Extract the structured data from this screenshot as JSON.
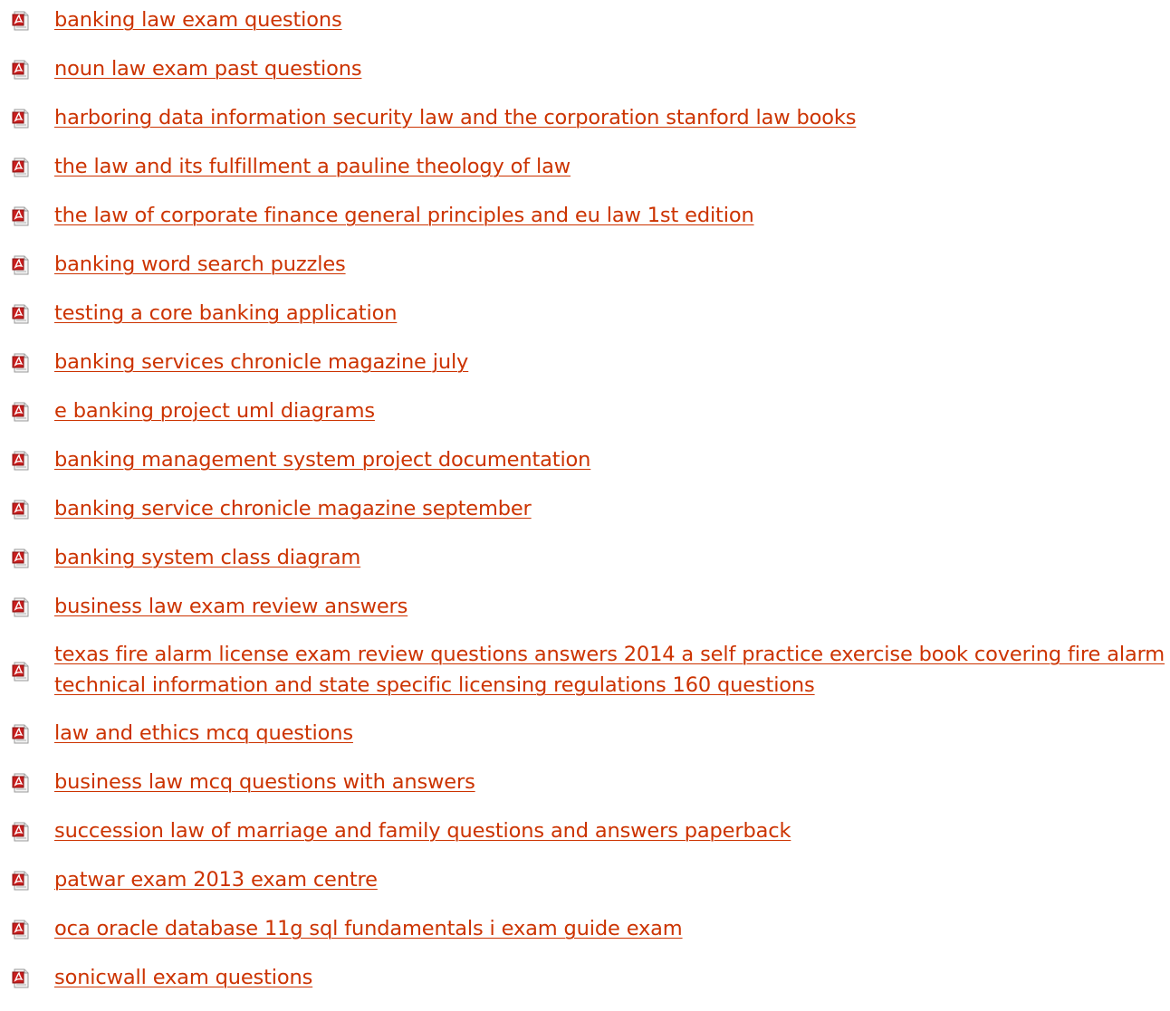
{
  "accent_color": "#cc3300",
  "icon": "pdf-file-icon",
  "links": [
    {
      "label": "banking law exam questions"
    },
    {
      "label": "noun law exam past questions"
    },
    {
      "label": "harboring data information security law and the corporation stanford law books"
    },
    {
      "label": "the law and its fulfillment a pauline theology of law"
    },
    {
      "label": "the law of corporate finance general principles and eu law 1st edition"
    },
    {
      "label": "banking word search puzzles"
    },
    {
      "label": "testing a core banking application"
    },
    {
      "label": "banking services chronicle magazine july"
    },
    {
      "label": "e banking project uml diagrams"
    },
    {
      "label": "banking management system project documentation"
    },
    {
      "label": "banking service chronicle magazine september"
    },
    {
      "label": "banking system class diagram"
    },
    {
      "label": "business law exam review answers"
    },
    {
      "label": "texas fire alarm license exam review questions answers 2014 a self practice exercise book covering fire alarm technical information and state specific licensing regulations 160 questions"
    },
    {
      "label": "law and ethics mcq questions"
    },
    {
      "label": "business law mcq questions with answers"
    },
    {
      "label": "succession law of marriage and family questions and answers paperback"
    },
    {
      "label": "patwar exam 2013 exam centre"
    },
    {
      "label": "oca oracle database 11g sql fundamentals i exam guide exam"
    },
    {
      "label": "sonicwall exam questions"
    }
  ]
}
